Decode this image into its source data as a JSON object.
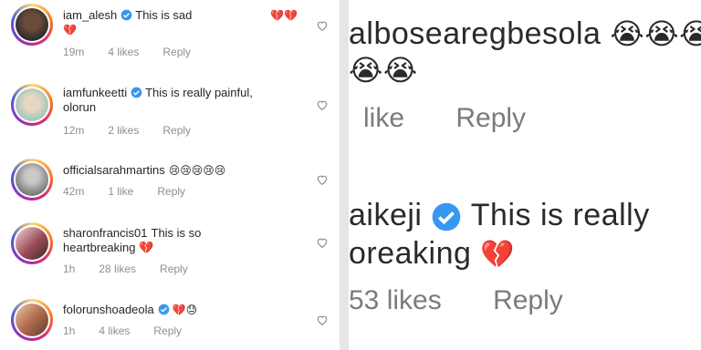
{
  "left_comments": [
    {
      "username": "iam_alesh",
      "verified": true,
      "text": "This is sad",
      "text_emoji_tail": "💔",
      "trail_emojis": "💔💔",
      "time": "19m",
      "likes": "4 likes",
      "reply": "Reply"
    },
    {
      "username": "iamfunkeetti",
      "verified": true,
      "text": "This is really painful,",
      "text_line2": "olorun",
      "time": "12m",
      "likes": "2 likes",
      "reply": "Reply"
    },
    {
      "username": "officialsarahmartins",
      "verified": false,
      "text": "😢😢😢😢😢",
      "time": "42m",
      "likes": "1 like",
      "reply": "Reply"
    },
    {
      "username": "sharonfrancis01",
      "verified": false,
      "text": "This is so",
      "text_line2": "heartbreaking 💔",
      "time": "1h",
      "likes": "28 likes",
      "reply": "Reply"
    },
    {
      "username": "folorunshoadeola",
      "verified": true,
      "text": "💔😓",
      "time": "1h",
      "likes": "4 likes",
      "reply": "Reply"
    }
  ],
  "right_zoom": {
    "line1": "albosearegbesola",
    "line1_emojis": "😭😭😭",
    "line2_emojis": "😭😭",
    "meta1_likes": "like",
    "meta1_reply": "Reply",
    "line3_user": "aikeji",
    "line3_text": "This is really",
    "line4_text": "oreaking",
    "line4_emoji": "💔",
    "meta2_likes": "53 likes",
    "meta2_reply": "Reply"
  },
  "colors": {
    "verified_blue": "#3897f0",
    "meta_gray": "#8e8e8e",
    "text": "#262626",
    "broken_heart": "#ed4956"
  }
}
